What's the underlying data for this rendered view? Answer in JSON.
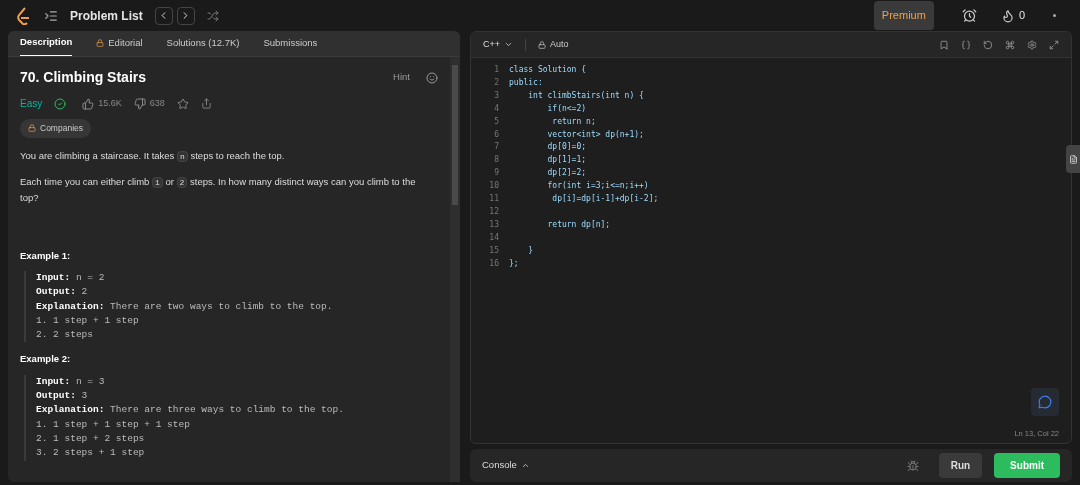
{
  "topbar": {
    "title": "Problem List",
    "premium": "Premium",
    "streak": "0"
  },
  "tabs": [
    {
      "label": "Description",
      "selected": true,
      "locked": false
    },
    {
      "label": "Editorial",
      "selected": false,
      "locked": true
    },
    {
      "label": "Solutions (12.7K)",
      "selected": false,
      "locked": false
    },
    {
      "label": "Submissions",
      "selected": false,
      "locked": false
    }
  ],
  "problem": {
    "title": "70. Climbing Stairs",
    "hint": "Hint",
    "difficulty": "Easy",
    "solved": true,
    "likes": "15.6K",
    "dislikes": "638",
    "companies": "Companies",
    "paragraphs": [
      [
        {
          "text": "You are climbing a staircase. It takes ",
          "kind": "plain"
        },
        {
          "text": "n",
          "kind": "code"
        },
        {
          "text": " steps to reach the top.",
          "kind": "plain"
        }
      ],
      [
        {
          "text": "Each time you can either climb ",
          "kind": "plain"
        },
        {
          "text": "1",
          "kind": "code"
        },
        {
          "text": " or ",
          "kind": "plain"
        },
        {
          "text": "2",
          "kind": "code"
        },
        {
          "text": " steps. In how many distinct ways can you climb to the top?",
          "kind": "plain"
        }
      ]
    ],
    "examples": [
      {
        "title": "Example 1:",
        "lines": [
          "**Input:** n = 2",
          "**Output:** 2",
          "**Explanation:** There are two ways to climb to the top.",
          "1. 1 step + 1 step",
          "2. 2 steps"
        ]
      },
      {
        "title": "Example 2:",
        "lines": [
          "**Input:** n = 3",
          "**Output:** 3",
          "**Explanation:** There are three ways to climb to the top.",
          "1. 1 step + 1 step + 1 step",
          "2. 1 step + 2 steps",
          "3. 2 steps + 1 step"
        ]
      }
    ]
  },
  "editor": {
    "language": "C++",
    "mode": "Auto",
    "cursor": "Ln 13, Col 22",
    "lines": [
      {
        "no": "1",
        "code": "class Solution {"
      },
      {
        "no": "2",
        "code": "public:"
      },
      {
        "no": "3",
        "code": "    int climbStairs(int n) {"
      },
      {
        "no": "4",
        "code": "        if(n<=2)"
      },
      {
        "no": "5",
        "code": "         return n;"
      },
      {
        "no": "6",
        "code": "        vector<int> dp(n+1);"
      },
      {
        "no": "7",
        "code": "        dp[0]=0;"
      },
      {
        "no": "8",
        "code": "        dp[1]=1;"
      },
      {
        "no": "9",
        "code": "        dp[2]=2;"
      },
      {
        "no": "10",
        "code": "        for(int i=3;i<=n;i++)"
      },
      {
        "no": "11",
        "code": "         dp[i]=dp[i-1]+dp[i-2];"
      },
      {
        "no": "12"
      },
      {
        "no": "13",
        "code": "        return dp[n];"
      },
      {
        "no": "14"
      },
      {
        "no": "15",
        "code": "    }"
      },
      {
        "no": "16",
        "code": "};"
      }
    ]
  },
  "console": {
    "label": "Console",
    "run": "Run",
    "submit": "Submit"
  }
}
